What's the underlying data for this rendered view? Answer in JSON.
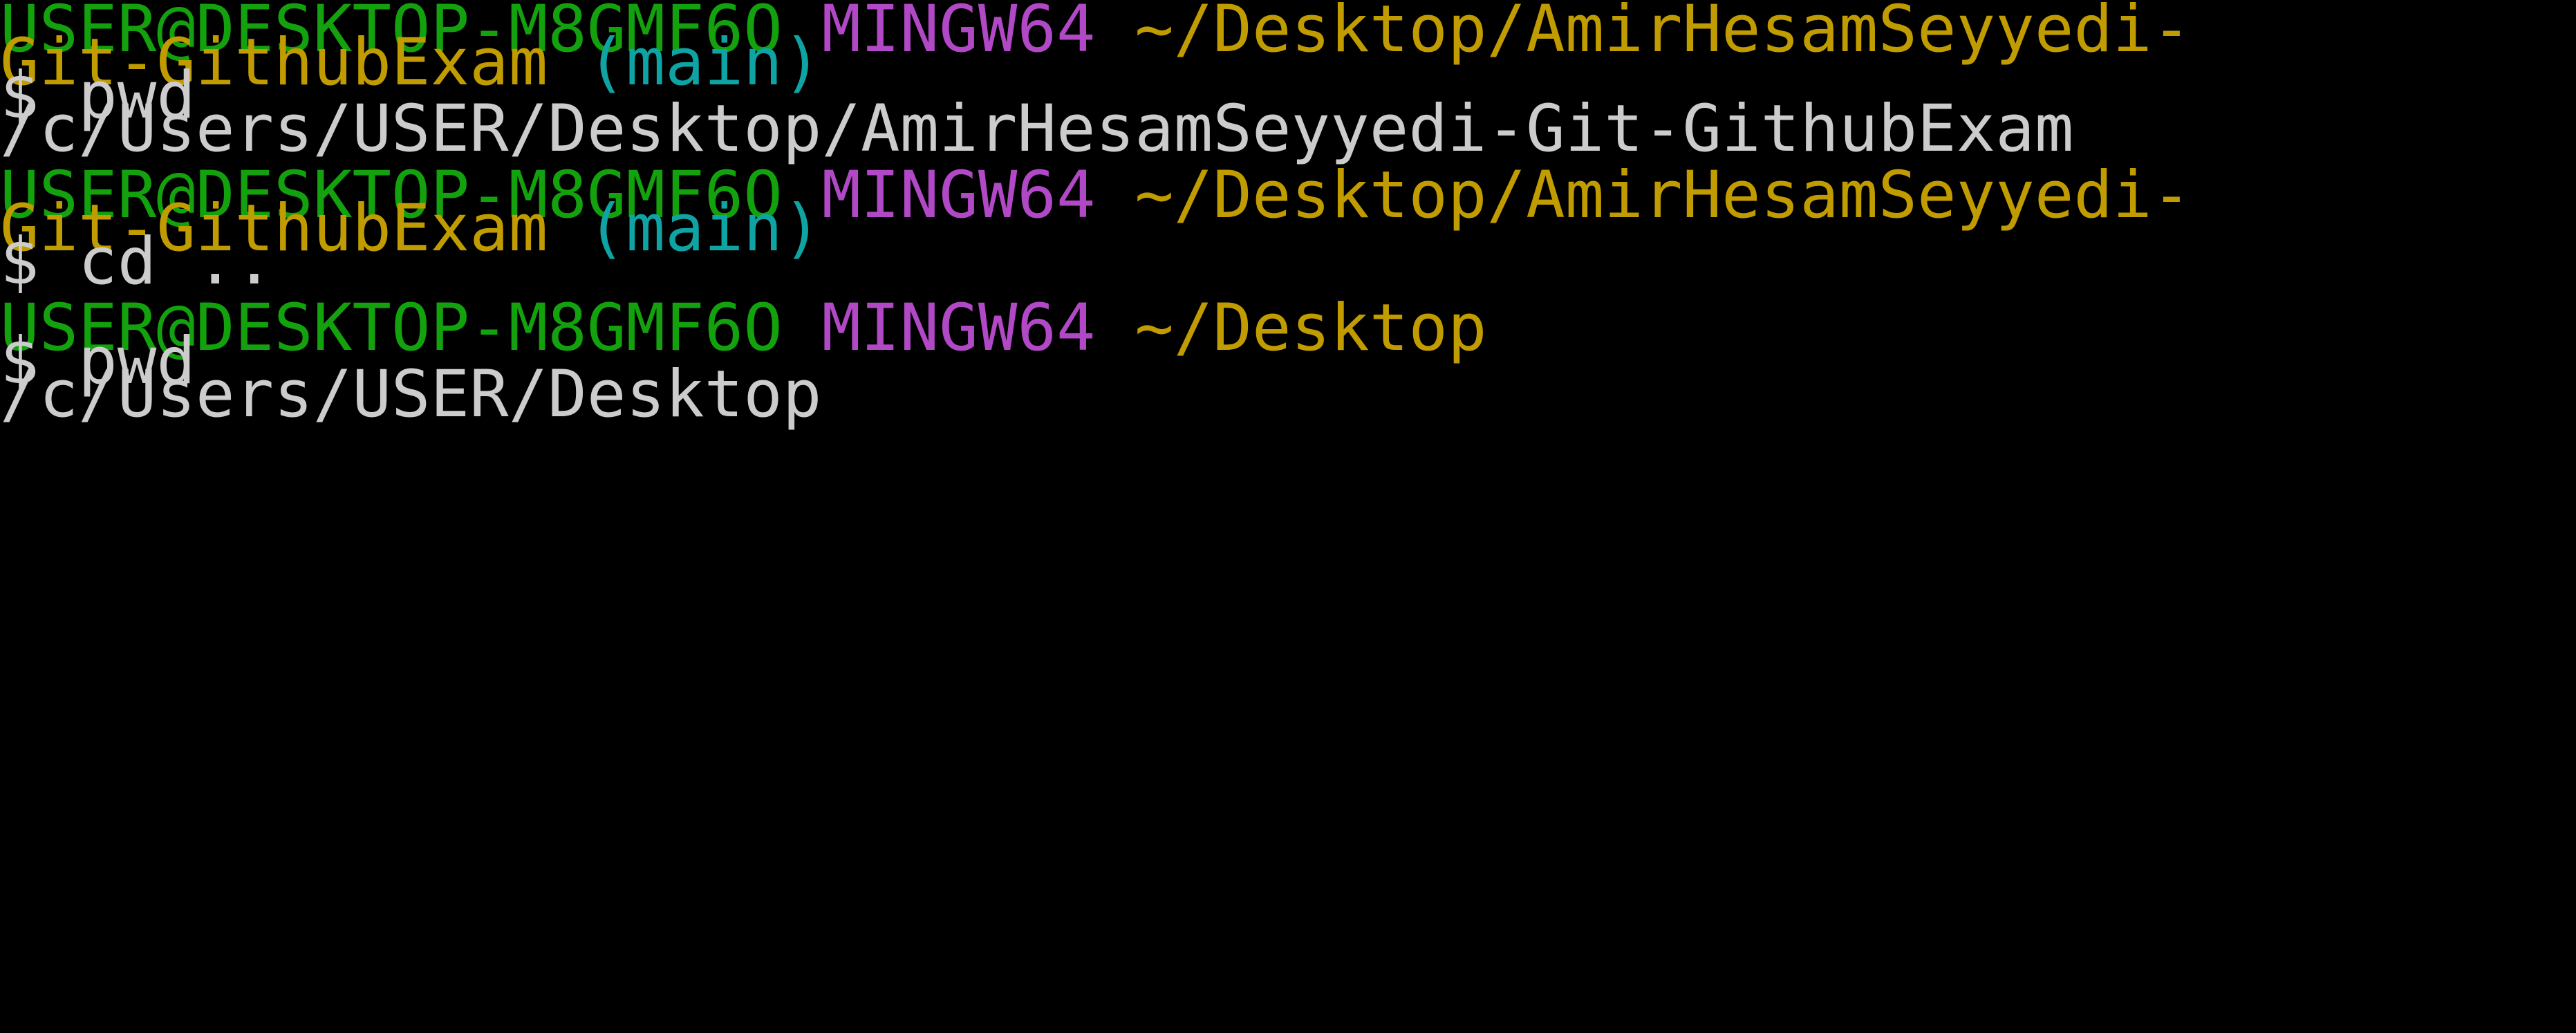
{
  "colors": {
    "background": "#000000",
    "user_host": "#13A10E",
    "shell_name": "#B148C6",
    "path": "#C19C00",
    "branch": "#0FA3A3",
    "text": "#CCCCCC"
  },
  "blocks": [
    {
      "prompt": {
        "user_host": "USER@DESKTOP-M8GMF6O",
        "shell": "MINGW64",
        "path_line1": "~/Desktop/AmirHesamSeyyedi-",
        "path_line2": "Git-GithubExam",
        "branch": "(main)"
      },
      "command": "$ pwd",
      "output": "/c/Users/USER/Desktop/AmirHesamSeyyedi-Git-GithubExam"
    },
    {
      "prompt": {
        "user_host": "USER@DESKTOP-M8GMF6O",
        "shell": "MINGW64",
        "path_line1": "~/Desktop/AmirHesamSeyyedi-",
        "path_line2": "Git-GithubExam",
        "branch": "(main)"
      },
      "command": "$ cd .."
    },
    {
      "prompt": {
        "user_host": "USER@DESKTOP-M8GMF6O",
        "shell": "MINGW64",
        "path_line1": "~/Desktop"
      },
      "command": "$ pwd",
      "output": "/c/Users/USER/Desktop"
    }
  ]
}
